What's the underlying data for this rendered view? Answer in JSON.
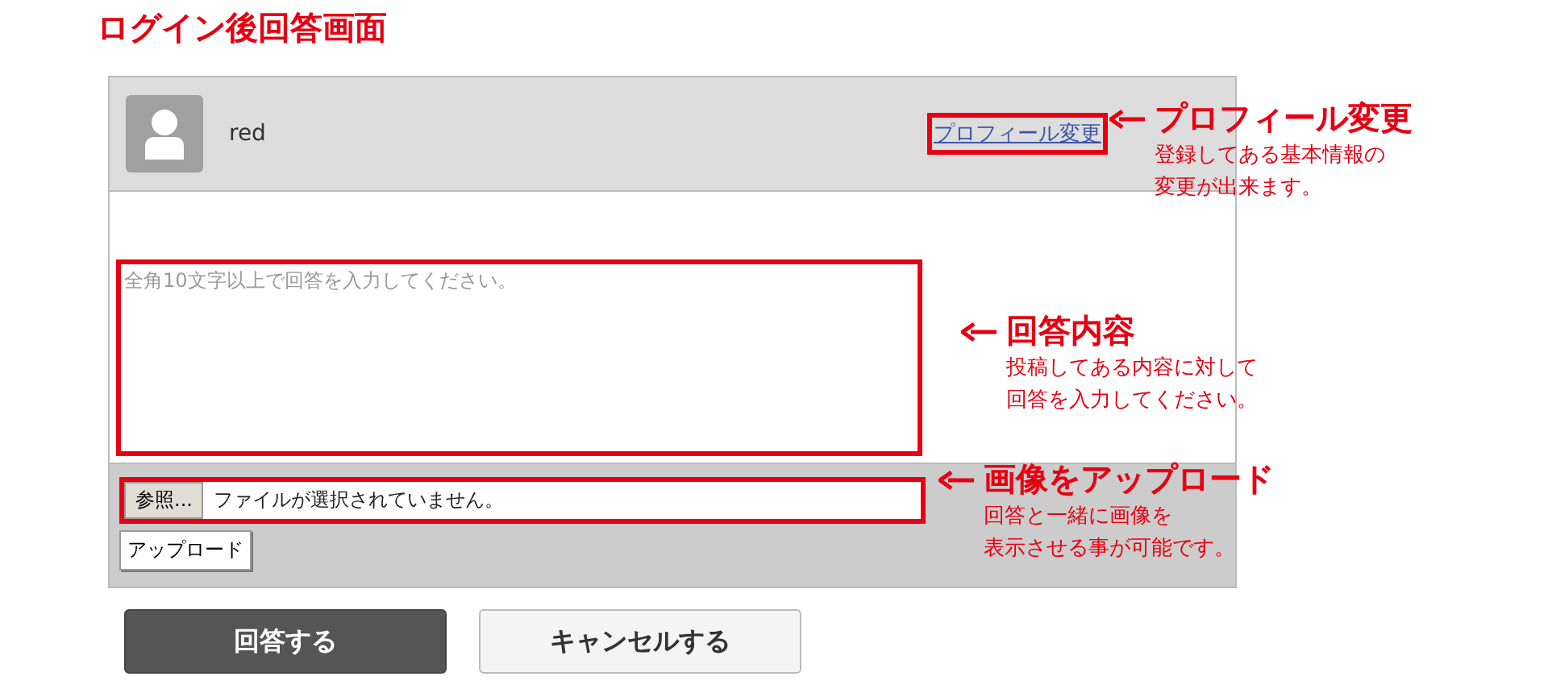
{
  "title": "ログイン後回答画面",
  "user": {
    "name": "red"
  },
  "profile_link": "プロフィール変更",
  "answer_field": {
    "placeholder": "全角10文字以上で回答を入力してください。"
  },
  "file": {
    "browse_button": "参照...",
    "status": "ファイルが選択されていません。"
  },
  "upload_button": "アップロード",
  "buttons": [
    {
      "label": "回答する",
      "kind": "primary"
    },
    {
      "label": "キャンセルする",
      "kind": "secondary"
    }
  ],
  "annotations": [
    {
      "heading": "プロフィール変更",
      "lines": [
        "登録してある基本情報の",
        "変更が出来ます。"
      ]
    },
    {
      "heading": "回答内容",
      "lines": [
        "投稿してある内容に対して",
        "回答を入力してください。"
      ]
    },
    {
      "heading": "画像をアップロード",
      "lines": [
        "回答と一緒に画像を",
        "表示させる事が可能です。"
      ]
    }
  ]
}
